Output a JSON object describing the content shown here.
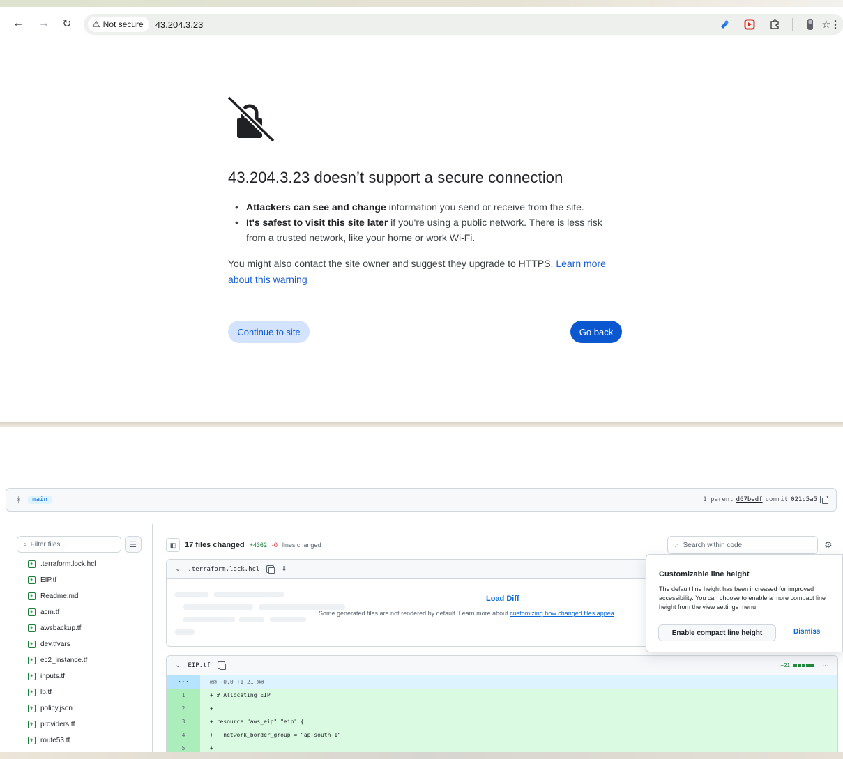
{
  "browser": {
    "security_chip": "Not secure",
    "url": "43.204.3.23",
    "icons": [
      "back-arrow-icon",
      "forward-arrow-icon",
      "reload-icon",
      "warning-triangle-icon",
      "star-icon",
      "extension-icon",
      "profile-icon",
      "kebab-menu-icon"
    ]
  },
  "interstitial": {
    "title": "43.204.3.23 doesn’t support a secure connection",
    "bullet1_bold": "Attackers can see and change",
    "bullet1_rest": " information you send or receive from the site.",
    "bullet2_bold": "It's safest to visit this site later",
    "bullet2_rest": " if you're using a public network. There is less risk from a trusted network, like your home or work Wi-Fi.",
    "contact_text": "You might also contact the site owner and suggest they upgrade to HTTPS. ",
    "learn_more": "Learn more about this warning",
    "continue_label": "Continue to site",
    "back_label": "Go back"
  },
  "github": {
    "branch": "main",
    "parent_label": "1 parent",
    "parent_sha": "d67bedf",
    "commit_label": "commit",
    "commit_sha": "021c5a5",
    "filter_placeholder": "Filter files...",
    "files": [
      ".terraform.lock.hcl",
      "EIP.tf",
      "Readme.md",
      "acm.tf",
      "awsbackup.tf",
      "dev.tfvars",
      "ec2_instance.tf",
      "inputs.tf",
      "lb.tf",
      "policy.json",
      "providers.tf",
      "route53.tf"
    ],
    "files_changed": "17 files changed",
    "additions": "+4362",
    "deletions": "-0",
    "lines_changed": "lines changed",
    "search_placeholder": "Search within code",
    "lock_card": {
      "filename": ".terraform.lock.hcl",
      "load_diff": "Load Diff",
      "note": "Some generated files are not rendered by default. Learn more about ",
      "note_link": "customizing how changed files appea"
    },
    "eip_card": {
      "filename": "EIP.tf",
      "additions": "+21",
      "hunk_dots": "···",
      "hunk": "@@ -0,0 +1,21 @@",
      "lines": [
        {
          "n": "1",
          "code": "+ # Allocating EIP"
        },
        {
          "n": "2",
          "code": "+"
        },
        {
          "n": "3",
          "code": "+ resource \"aws_eip\" \"eip\" {"
        },
        {
          "n": "4",
          "code": "+   network_border_group = \"ap-south-1\""
        },
        {
          "n": "5",
          "code": "+"
        }
      ]
    },
    "popover": {
      "title": "Customizable line height",
      "body": "The default line height has been increased for improved accessibility. You can choose to enable a more compact line height from the view settings menu.",
      "enable_label": "Enable compact line height",
      "dismiss_label": "Dismiss"
    }
  }
}
